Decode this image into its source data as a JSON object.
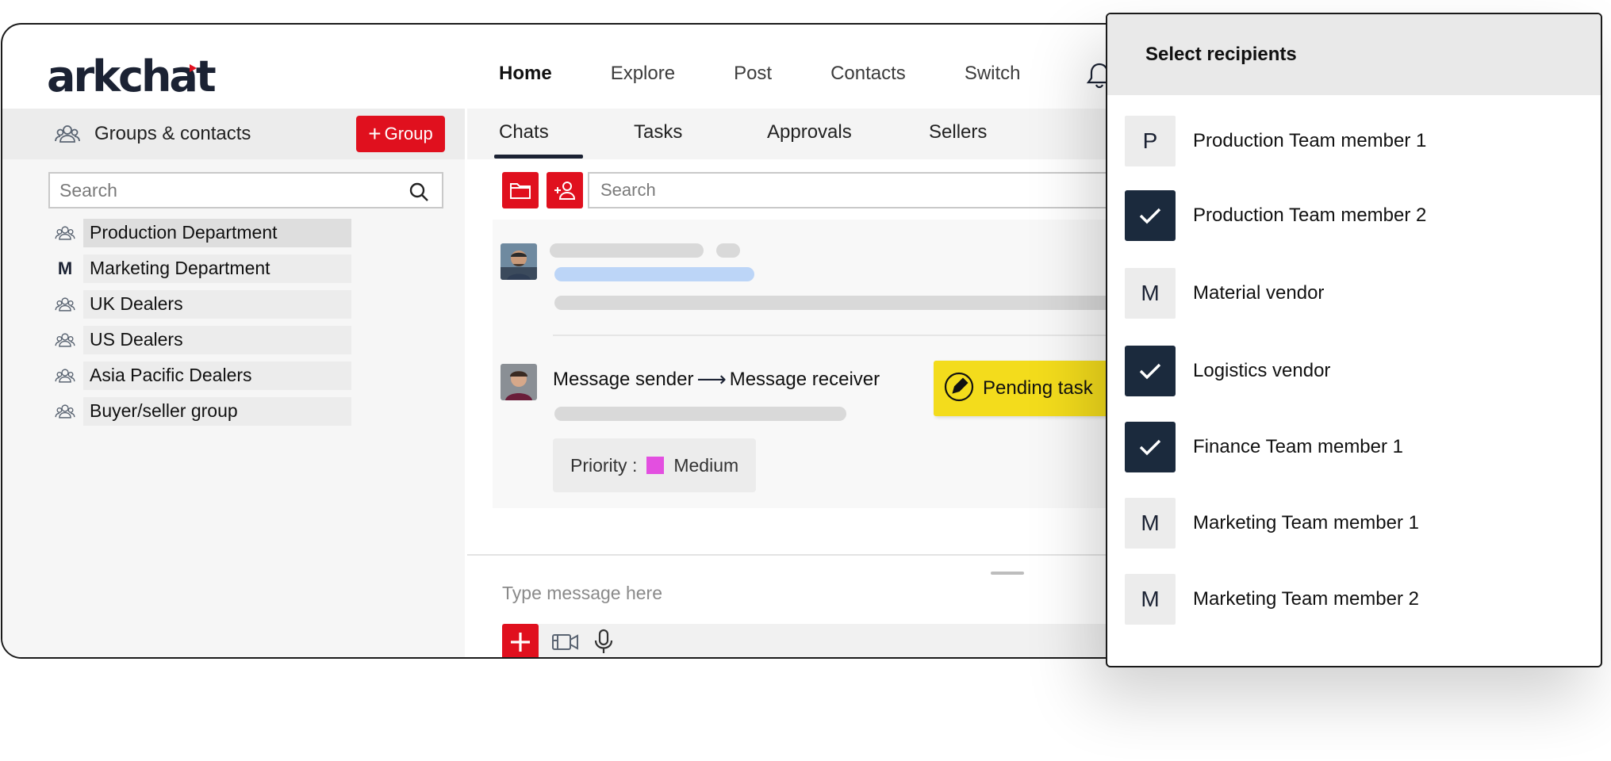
{
  "brand": {
    "logo_text": "arkchat",
    "accent": "#e0101e",
    "navy": "#1b2233"
  },
  "nav": {
    "items": [
      "Home",
      "Explore",
      "Post",
      "Contacts",
      "Switch"
    ],
    "active": "Home"
  },
  "sidebar": {
    "header_label": "Groups & contacts",
    "add_group_label": "Group",
    "search_placeholder": "Search",
    "items": [
      {
        "icon": "group-icon",
        "label": "Production Department",
        "selected": true
      },
      {
        "icon": "M",
        "label": "Marketing Department"
      },
      {
        "icon": "group-icon",
        "label": "UK Dealers"
      },
      {
        "icon": "group-icon",
        "label": "US Dealers"
      },
      {
        "icon": "group-icon",
        "label": "Asia Pacific Dealers"
      },
      {
        "icon": "group-icon",
        "label": "Buyer/seller group"
      }
    ]
  },
  "main": {
    "tabs": [
      "Chats",
      "Tasks",
      "Approvals",
      "Sellers"
    ],
    "active_tab": "Chats",
    "search_placeholder": "Search",
    "message": {
      "sender": "Message sender",
      "arrow": "⟶",
      "receiver": "Message receiver",
      "status": "Pending task",
      "priority_label": "Priority :",
      "priority_value": "Medium",
      "priority_color": "#e34fe0",
      "status_color": "#f3dc1c"
    },
    "composer_placeholder": "Type message here"
  },
  "recipients": {
    "title": "Select recipients",
    "items": [
      {
        "badge": "P",
        "label": "Production Team member 1",
        "checked": false
      },
      {
        "badge": "",
        "label": "Production Team member 2",
        "checked": true
      },
      {
        "badge": "M",
        "label": "Material vendor",
        "checked": false
      },
      {
        "badge": "",
        "label": "Logistics vendor",
        "checked": true
      },
      {
        "badge": "",
        "label": "Finance Team member 1",
        "checked": true
      },
      {
        "badge": "M",
        "label": "Marketing Team member 1",
        "checked": false
      },
      {
        "badge": "M",
        "label": "Marketing Team member 2",
        "checked": false
      }
    ]
  }
}
